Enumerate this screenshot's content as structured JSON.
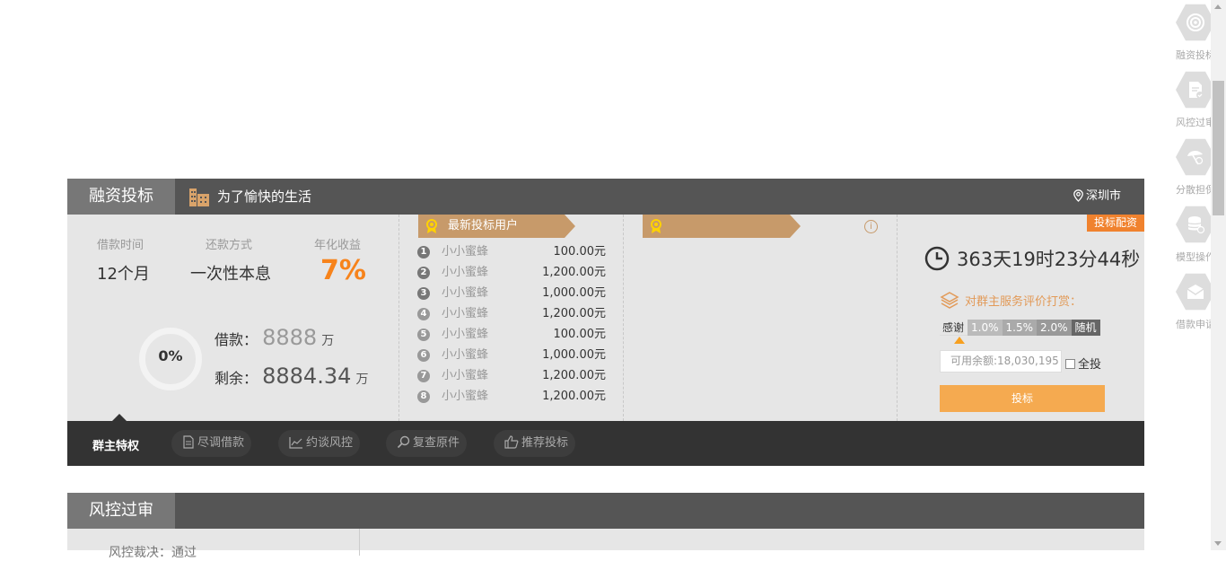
{
  "panel": {
    "tab_label": "融资投标",
    "title": "为了愉快的生活",
    "city": "深圳市",
    "loan_term_label": "借款时间",
    "loan_term_value": "12个月",
    "repay_label": "还款方式",
    "repay_value": "一次性本息",
    "yield_label": "年化收益",
    "yield_value": "7%",
    "progress_text": "0%",
    "progress": 0,
    "borrow_label": "借款：",
    "borrow_amount": "8888",
    "borrow_unit": "万",
    "remain_label": "剩余：",
    "remain_amount": "8884.34",
    "remain_unit": "万"
  },
  "latest_bidders": {
    "title": "最新投标用户",
    "rows": [
      {
        "rank": "1",
        "name": "小小蜜蜂",
        "amount": "100.00元"
      },
      {
        "rank": "2",
        "name": "小小蜜蜂",
        "amount": "1,200.00元"
      },
      {
        "rank": "3",
        "name": "小小蜜蜂",
        "amount": "1,000.00元"
      },
      {
        "rank": "4",
        "name": "小小蜜蜂",
        "amount": "1,200.00元"
      },
      {
        "rank": "5",
        "name": "小小蜜蜂",
        "amount": "100.00元"
      },
      {
        "rank": "6",
        "name": "小小蜜蜂",
        "amount": "1,000.00元"
      },
      {
        "rank": "7",
        "name": "小小蜜蜂",
        "amount": "1,200.00元"
      },
      {
        "rank": "8",
        "name": "小小蜜蜂",
        "amount": "1,200.00元"
      }
    ]
  },
  "right": {
    "badge": "投标配资",
    "countdown": "363天19时23分44秒",
    "rate_prompt": "对群主服务评价打赏：",
    "tips": [
      "感谢",
      "1.0%",
      "1.5%",
      "2.0%",
      "随机"
    ],
    "balance_placeholder": "可用余额:18,030,195",
    "all_in_label": "全投",
    "bid_button": "投标"
  },
  "bottom_bar": {
    "active": "群主特权",
    "pills": [
      "尽调借款",
      "约谈风控",
      "复查原件",
      "推荐投标"
    ]
  },
  "panel2": {
    "tab_label": "风控过审",
    "row_text": "风控裁决：通过"
  },
  "side_nav": [
    {
      "label": "融资投标",
      "icon": "target-icon"
    },
    {
      "label": "风控过审",
      "icon": "document-check-icon"
    },
    {
      "label": "分散担保",
      "icon": "umbrella-money-icon"
    },
    {
      "label": "模型操作",
      "icon": "database-icon"
    },
    {
      "label": "借款申请",
      "icon": "envelope-icon"
    }
  ],
  "colors": {
    "accent_orange": "#f7831b",
    "ribbon": "#c79a6a",
    "bid_button": "#f5aa50",
    "header": "#555555"
  }
}
